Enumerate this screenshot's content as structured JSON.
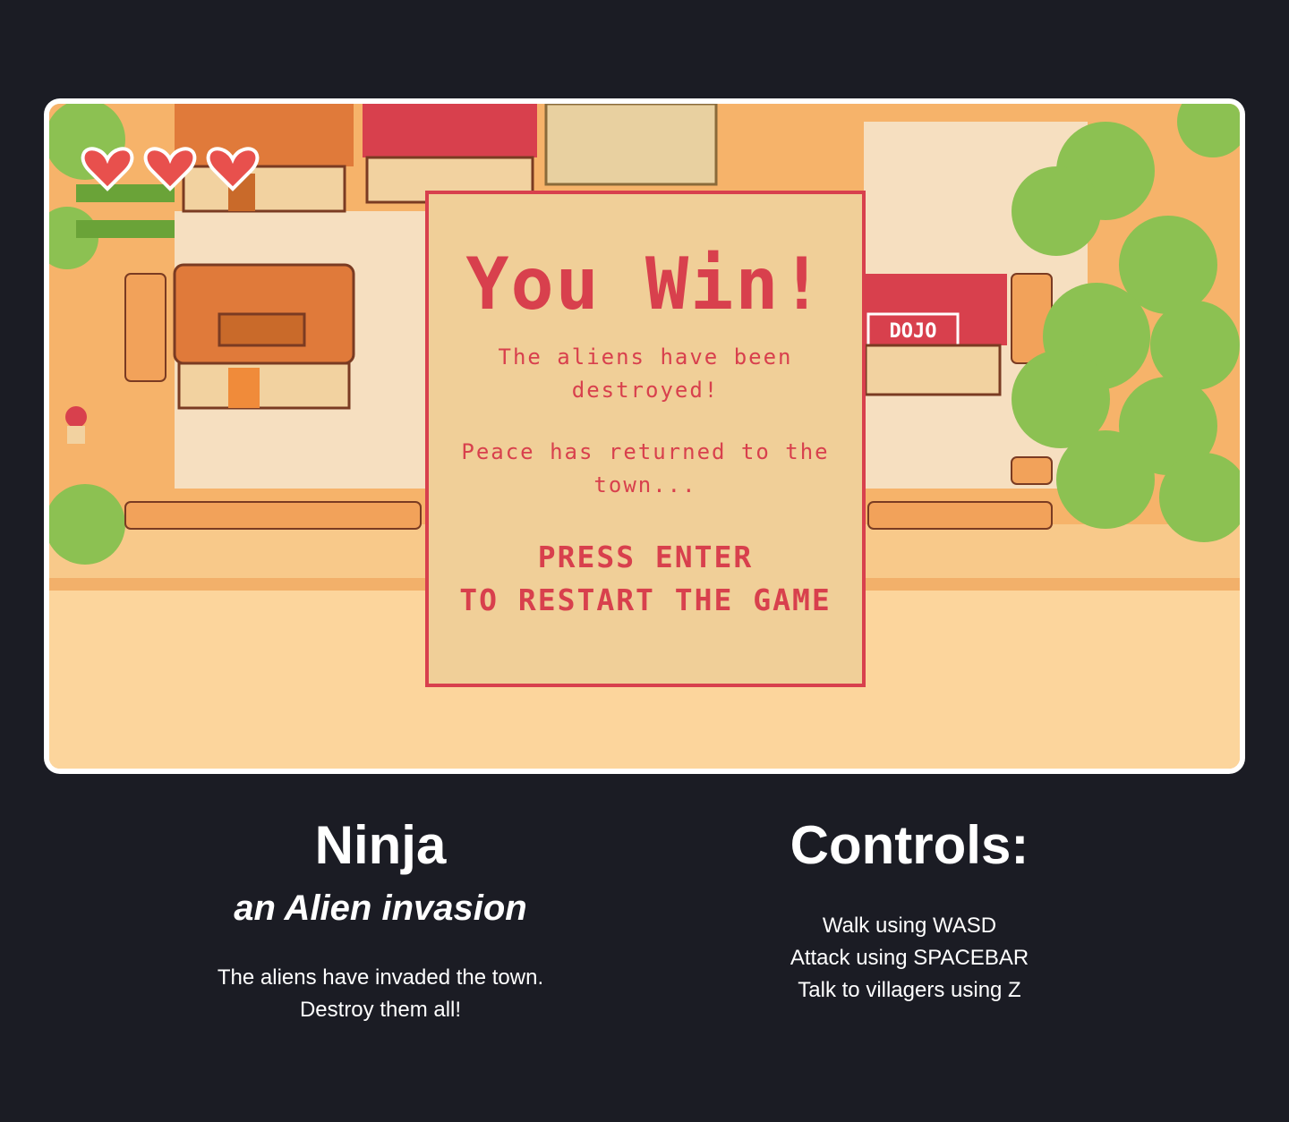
{
  "game": {
    "hearts": 3,
    "sign_text": "DOJO",
    "overlay": {
      "title": "You Win!",
      "line1": "The aliens have been destroyed!",
      "line2": "Peace has returned to the town...",
      "press_line1": "PRESS ENTER",
      "press_line2": "TO RESTART THE GAME"
    }
  },
  "info": {
    "title": "Ninja",
    "subtitle": "an Alien invasion",
    "description_line1": "The aliens have invaded the town.",
    "description_line2": "Destroy them all!"
  },
  "controls": {
    "title": "Controls:",
    "items": [
      "Walk using WASD",
      "Attack using SPACEBAR",
      "Talk to villagers using Z"
    ]
  },
  "colors": {
    "page_bg": "#1b1c24",
    "accent": "#d8404d",
    "overlay_bg": "#f0cf98",
    "sand": "#f8c98a",
    "tree": "#7cb342",
    "roof": "#e07a3a"
  }
}
